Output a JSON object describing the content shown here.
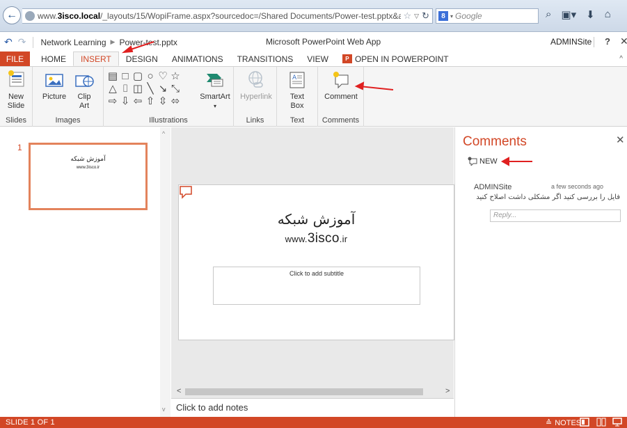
{
  "browser": {
    "back_label": "←",
    "url_prefix": "www.",
    "url_host": "3isco.local",
    "url_rest": "/_layouts/15/WopiFrame.aspx?sourcedoc=/Shared Documents/Power-test.pptx&actio",
    "search_engine_label": "8",
    "search_placeholder": "Google",
    "icons": [
      "search-icon",
      "bookmarks-icon",
      "download-icon",
      "home-icon"
    ]
  },
  "app_header": {
    "breadcrumb": [
      "Network Learning",
      "Power-test.pptx"
    ],
    "app_name": "Microsoft PowerPoint Web App",
    "user": "ADMINSite",
    "help": "?",
    "close": "✕"
  },
  "ribbon_tabs": [
    {
      "label": "FILE"
    },
    {
      "label": "HOME"
    },
    {
      "label": "INSERT"
    },
    {
      "label": "DESIGN"
    },
    {
      "label": "ANIMATIONS"
    },
    {
      "label": "TRANSITIONS"
    },
    {
      "label": "VIEW"
    },
    {
      "label": "OPEN IN POWERPOINT"
    }
  ],
  "ribbon": {
    "groups": {
      "slides": "Slides",
      "images": "Images",
      "illustrations": "Illustrations",
      "links": "Links",
      "text": "Text",
      "comments": "Comments"
    },
    "buttons": {
      "new_slide": [
        "New",
        "Slide"
      ],
      "picture": "Picture",
      "clip_art": [
        "Clip",
        "Art"
      ],
      "smartart": "SmartArt",
      "hyperlink": "Hyperlink",
      "text_box": [
        "Text",
        "Box"
      ],
      "comment": "Comment"
    }
  },
  "slide_panel": {
    "slide_number": "1",
    "thumb_title": "آموزش شبکه",
    "thumb_sub": "www.3isco.ir"
  },
  "slide": {
    "title": "آموزش شبکه",
    "sub_prefix": "www.",
    "sub_big": "3isco",
    "sub_suffix": ".ir",
    "subtitle_placeholder": "Click to add subtitle",
    "notes_placeholder": "Click to add notes"
  },
  "comments": {
    "title": "Comments",
    "new_label": "NEW",
    "author": "ADMINSite",
    "time": "a few seconds ago",
    "text": "فایل را بررسی کنید اگر مشکلی داشت اصلاح کنید",
    "reply_placeholder": "Reply..."
  },
  "status": {
    "slide_label": "SLIDE 1 OF 1",
    "notes_label": "NOTES"
  },
  "colors": {
    "accent": "#d24726",
    "annotation": "#e02020"
  }
}
